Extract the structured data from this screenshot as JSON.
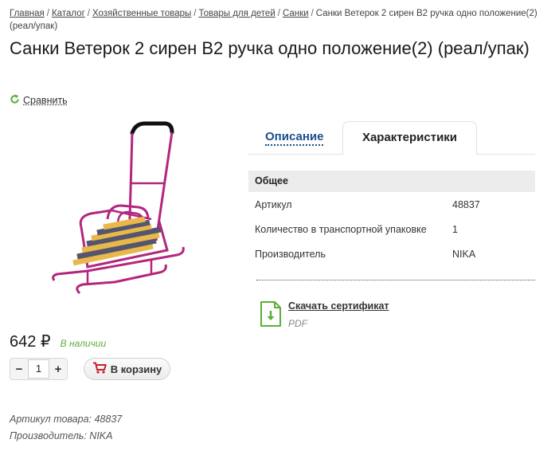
{
  "breadcrumb": {
    "items": [
      "Главная",
      "Каталог",
      "Хозяйственные товары",
      "Товары для детей",
      "Санки"
    ],
    "current": "Санки Ветерок 2 сирен В2 ручка одно положение(2) (реал/упак)",
    "separator": "/"
  },
  "product": {
    "title": "Санки Ветерок 2 сирен В2 ручка одно положение(2) (реал/упак)",
    "compare_label": "Сравнить",
    "price": "642 ₽",
    "stock": "В наличии",
    "quantity": "1",
    "qty_minus": "−",
    "qty_plus": "+",
    "cart_label": "В корзину",
    "meta_article": "Артикул товара: 48837",
    "meta_maker": "Производитель: NIKA"
  },
  "tabs": {
    "description": "Описание",
    "characteristics": "Характеристики"
  },
  "specs": {
    "group": "Общее",
    "rows": [
      {
        "key": "Артикул",
        "value": "48837"
      },
      {
        "key": "Количество в транспортной упаковке",
        "value": "1"
      },
      {
        "key": "Производитель",
        "value": "NIKA"
      }
    ]
  },
  "certificate": {
    "link": "Скачать сертификат",
    "type": "PDF"
  },
  "colors": {
    "accent_green": "#5cae3a",
    "link_blue": "#1b4f8a",
    "cart_red": "#c8202f",
    "sled_frame": "#b3267e"
  },
  "icons": [
    "compare-icon",
    "cart-icon",
    "document-download-icon"
  ]
}
